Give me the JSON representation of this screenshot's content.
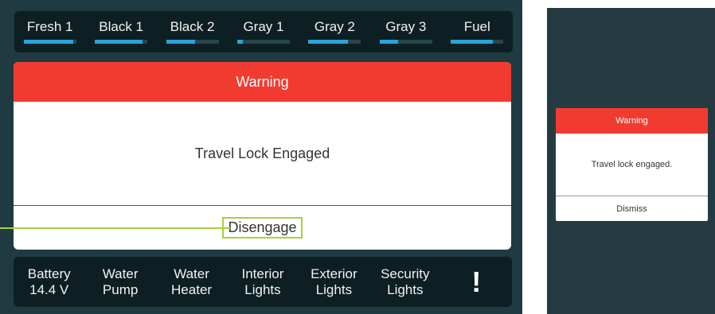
{
  "colors": {
    "panel_background": "#1f3a40",
    "bar_background": "#0d1f23",
    "warning_red": "#f23b30",
    "tank_fill": "#2aa3da",
    "highlight_green": "#a6d13d"
  },
  "tanks": [
    {
      "label": "Fresh 1",
      "level": 0.95
    },
    {
      "label": "Black 1",
      "level": 0.9
    },
    {
      "label": "Black 2",
      "level": 0.55
    },
    {
      "label": "Gray 1",
      "level": 0.1
    },
    {
      "label": "Gray 2",
      "level": 0.75
    },
    {
      "label": "Gray 3",
      "level": 0.35
    },
    {
      "label": "Fuel",
      "level": 0.8
    }
  ],
  "dialog": {
    "title": "Warning",
    "message": "Travel Lock Engaged",
    "action": "Disengage"
  },
  "controls": [
    {
      "line1": "Battery",
      "line2": "14.4 V"
    },
    {
      "line1": "Water",
      "line2": "Pump"
    },
    {
      "line1": "Water",
      "line2": "Heater"
    },
    {
      "line1": "Interior",
      "line2": "Lights"
    },
    {
      "line1": "Exterior",
      "line2": "Lights"
    },
    {
      "line1": "Security",
      "line2": "Lights"
    }
  ],
  "alert_icon": {
    "icon": "exclamation-icon",
    "glyph": "!"
  },
  "mini_dialog": {
    "title": "Warning",
    "message": "Travel lock engaged.",
    "action": "Dismiss"
  }
}
